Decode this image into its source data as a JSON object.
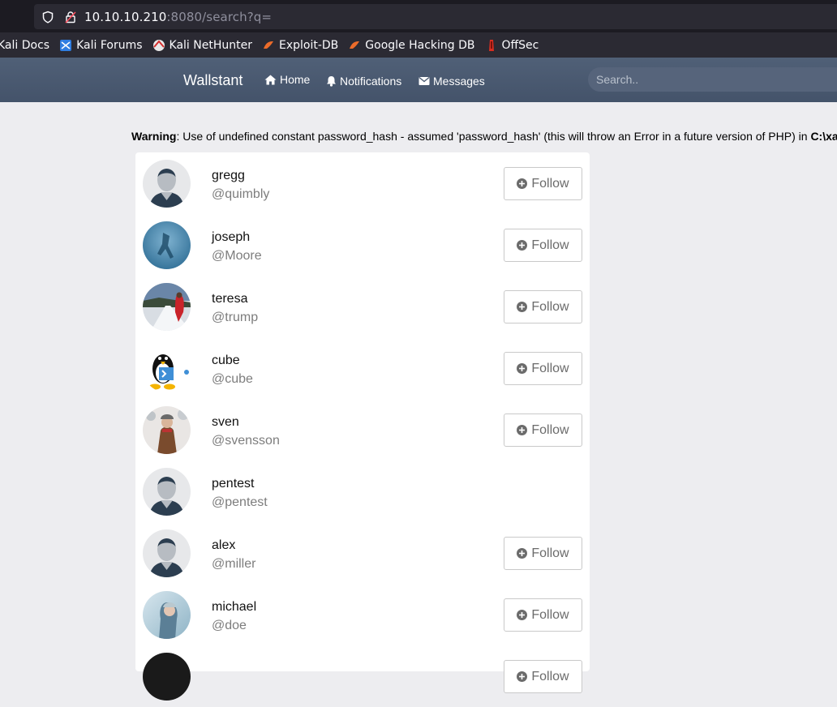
{
  "browser": {
    "url_host": "10.10.10.210",
    "url_rest": ":8080/search?q=",
    "bookmarks": [
      {
        "label": "Kali Docs",
        "icon": "kali-docs-icon"
      },
      {
        "label": "Kali Forums",
        "icon": "kali-forums-icon"
      },
      {
        "label": "Kali NetHunter",
        "icon": "nethunter-icon"
      },
      {
        "label": "Exploit-DB",
        "icon": "exploit-db-icon"
      },
      {
        "label": "Google Hacking DB",
        "icon": "ghdb-icon"
      },
      {
        "label": "OffSec",
        "icon": "offsec-icon"
      }
    ]
  },
  "navbar": {
    "brand": "Wallstant",
    "home": "Home",
    "notifications": "Notifications",
    "messages": "Messages",
    "search_placeholder": "Search.."
  },
  "warning": {
    "label": "Warning",
    "message": ": Use of undefined constant password_hash - assumed 'password_hash' (this will throw an Error in a future version of PHP) in ",
    "path": "C:\\xampp"
  },
  "follow_label": "Follow",
  "users": [
    {
      "name": "gregg",
      "handle": "@quimbly",
      "avatar": "default",
      "follow": true
    },
    {
      "name": "joseph",
      "handle": "@Moore",
      "avatar": "blue-photo",
      "follow": true
    },
    {
      "name": "teresa",
      "handle": "@trump",
      "avatar": "snow-road-photo",
      "follow": true
    },
    {
      "name": "cube",
      "handle": "@cube",
      "avatar": "tux-powershell",
      "follow": true
    },
    {
      "name": "sven",
      "handle": "@svensson",
      "avatar": "winter-person-photo",
      "follow": true
    },
    {
      "name": "pentest",
      "handle": "@pentest",
      "avatar": "default",
      "follow": false
    },
    {
      "name": "alex",
      "handle": "@miller",
      "avatar": "default",
      "follow": true
    },
    {
      "name": "michael",
      "handle": "@doe",
      "avatar": "snow-portrait-photo",
      "follow": true
    },
    {
      "name": "",
      "handle": "",
      "avatar": "dark",
      "follow": true
    }
  ],
  "colors": {
    "navbar": "#4a5a71",
    "page_bg": "#ededf0",
    "card_bg": "#ffffff",
    "handle": "#7d7d7d"
  }
}
